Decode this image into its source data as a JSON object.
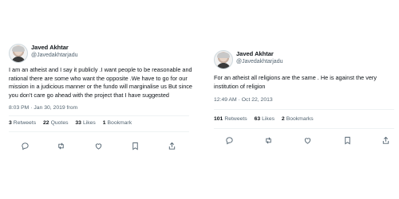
{
  "tweets": [
    {
      "author": {
        "display_name": "Javed Akhtar",
        "handle": "@Javedakhtarjadu"
      },
      "text": "I am an atheist and I say it publicly .I want people to be reasonable and rational there are some who want the opposite .We have to go for our mission in a judicious manner or the fundo will marginalise us But since you don't care go ahead with the project that I have suggested",
      "timestamp": "8:03 PM · Jan 30, 2019 from",
      "stats": [
        {
          "count": "3",
          "label": "Retweets"
        },
        {
          "count": "22",
          "label": "Quotes"
        },
        {
          "count": "33",
          "label": "Likes"
        },
        {
          "count": "1",
          "label": "Bookmark"
        }
      ],
      "actions": [
        "reply-icon",
        "retweet-icon",
        "like-icon",
        "bookmark-icon",
        "share-icon"
      ]
    },
    {
      "author": {
        "display_name": "Javed Akhtar",
        "handle": "@Javedakhtarjadu"
      },
      "text": "For an atheist all religions are the same . He is against the very institution of religion",
      "timestamp": "12:49 AM · Oct 22, 2013",
      "stats": [
        {
          "count": "101",
          "label": "Retweets"
        },
        {
          "count": "63",
          "label": "Likes"
        },
        {
          "count": "2",
          "label": "Bookmarks"
        }
      ],
      "actions": [
        "reply-icon",
        "retweet-icon",
        "like-icon",
        "bookmark-icon",
        "share-icon"
      ]
    }
  ]
}
